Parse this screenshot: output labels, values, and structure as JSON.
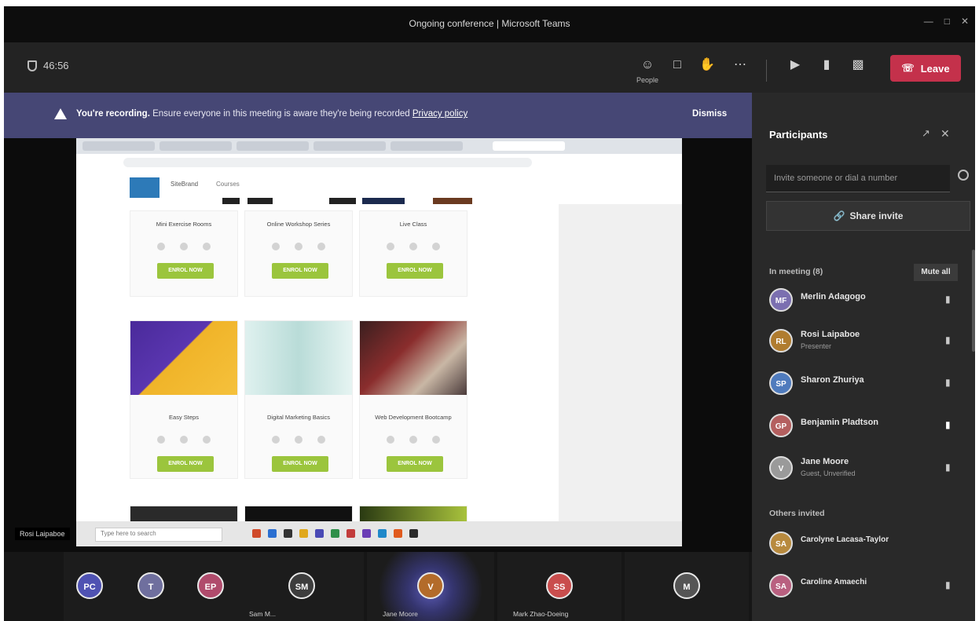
{
  "window": {
    "title": "Ongoing conference | Microsoft Teams"
  },
  "toolbar": {
    "timer": "46:56",
    "people_label": "People",
    "leave_label": "Leave"
  },
  "banner": {
    "bold": "You're recording.",
    "text": "Ensure everyone in this meeting is aware they're being recorded",
    "link": "Privacy policy",
    "dismiss": "Dismiss"
  },
  "shared_screen": {
    "site_name": "SiteBrand",
    "site_menu": "Courses",
    "presenter_label": "Rosi Laipaboe",
    "cards": [
      {
        "title": "Mini Exercise Rooms",
        "button": "ENROL NOW"
      },
      {
        "title": "Online Workshop Series",
        "button": "ENROL NOW"
      },
      {
        "title": "Live Class",
        "button": "ENROL NOW"
      },
      {
        "title": "Easy Steps",
        "button": "ENROL NOW"
      },
      {
        "title": "Digital Marketing Basics",
        "button": "ENROL NOW"
      },
      {
        "title": "Web Development Bootcamp",
        "button": "ENROL NOW"
      }
    ],
    "taskbar_search": "Type here to search"
  },
  "gallery": [
    {
      "initials": "PC",
      "name": "",
      "color": "#4f52b2"
    },
    {
      "initials": "T",
      "name": "",
      "color": "#6f6f9e"
    },
    {
      "initials": "EP",
      "name": "",
      "color": "#b04b6c"
    },
    {
      "initials": "SM",
      "name": "Sam M...",
      "color": "#3d3d3d"
    },
    {
      "initials": "V",
      "name": "Jane Moore",
      "color": "#b36b2a"
    },
    {
      "initials": "SS",
      "name": "Mark Zhao-Doeing",
      "color": "#c94d4d"
    },
    {
      "initials": "M",
      "name": "",
      "color": "#555"
    }
  ],
  "panel": {
    "title": "Participants",
    "invite_placeholder": "Invite someone or dial a number",
    "share_label": "Share invite",
    "in_meeting_label": "In meeting (8)",
    "mute_all": "Mute all",
    "others_label": "Others invited",
    "participants": [
      {
        "initials": "MF",
        "name": "Merlin Adagogo",
        "sub": "",
        "color": "#7b6fb0"
      },
      {
        "initials": "RL",
        "name": "Rosi Laipaboe",
        "sub": "Presenter",
        "color": "#b07c2f"
      },
      {
        "initials": "SP",
        "name": "Sharon Zhuriya",
        "sub": "",
        "color": "#4f7bbd"
      },
      {
        "initials": "GP",
        "name": "Benjamin Pladtson",
        "sub": "",
        "color": "#b45f5f"
      },
      {
        "initials": "V",
        "name": "Jane Moore",
        "sub": "Guest, Unverified",
        "color": "#9a9a9a"
      }
    ],
    "invited": [
      {
        "initials": "SA",
        "name": "Carolyne Lacasa-Taylor",
        "color": "#b88a3e"
      },
      {
        "initials": "SA",
        "name": "Caroline Amaechi",
        "color": "#b96080"
      }
    ]
  }
}
